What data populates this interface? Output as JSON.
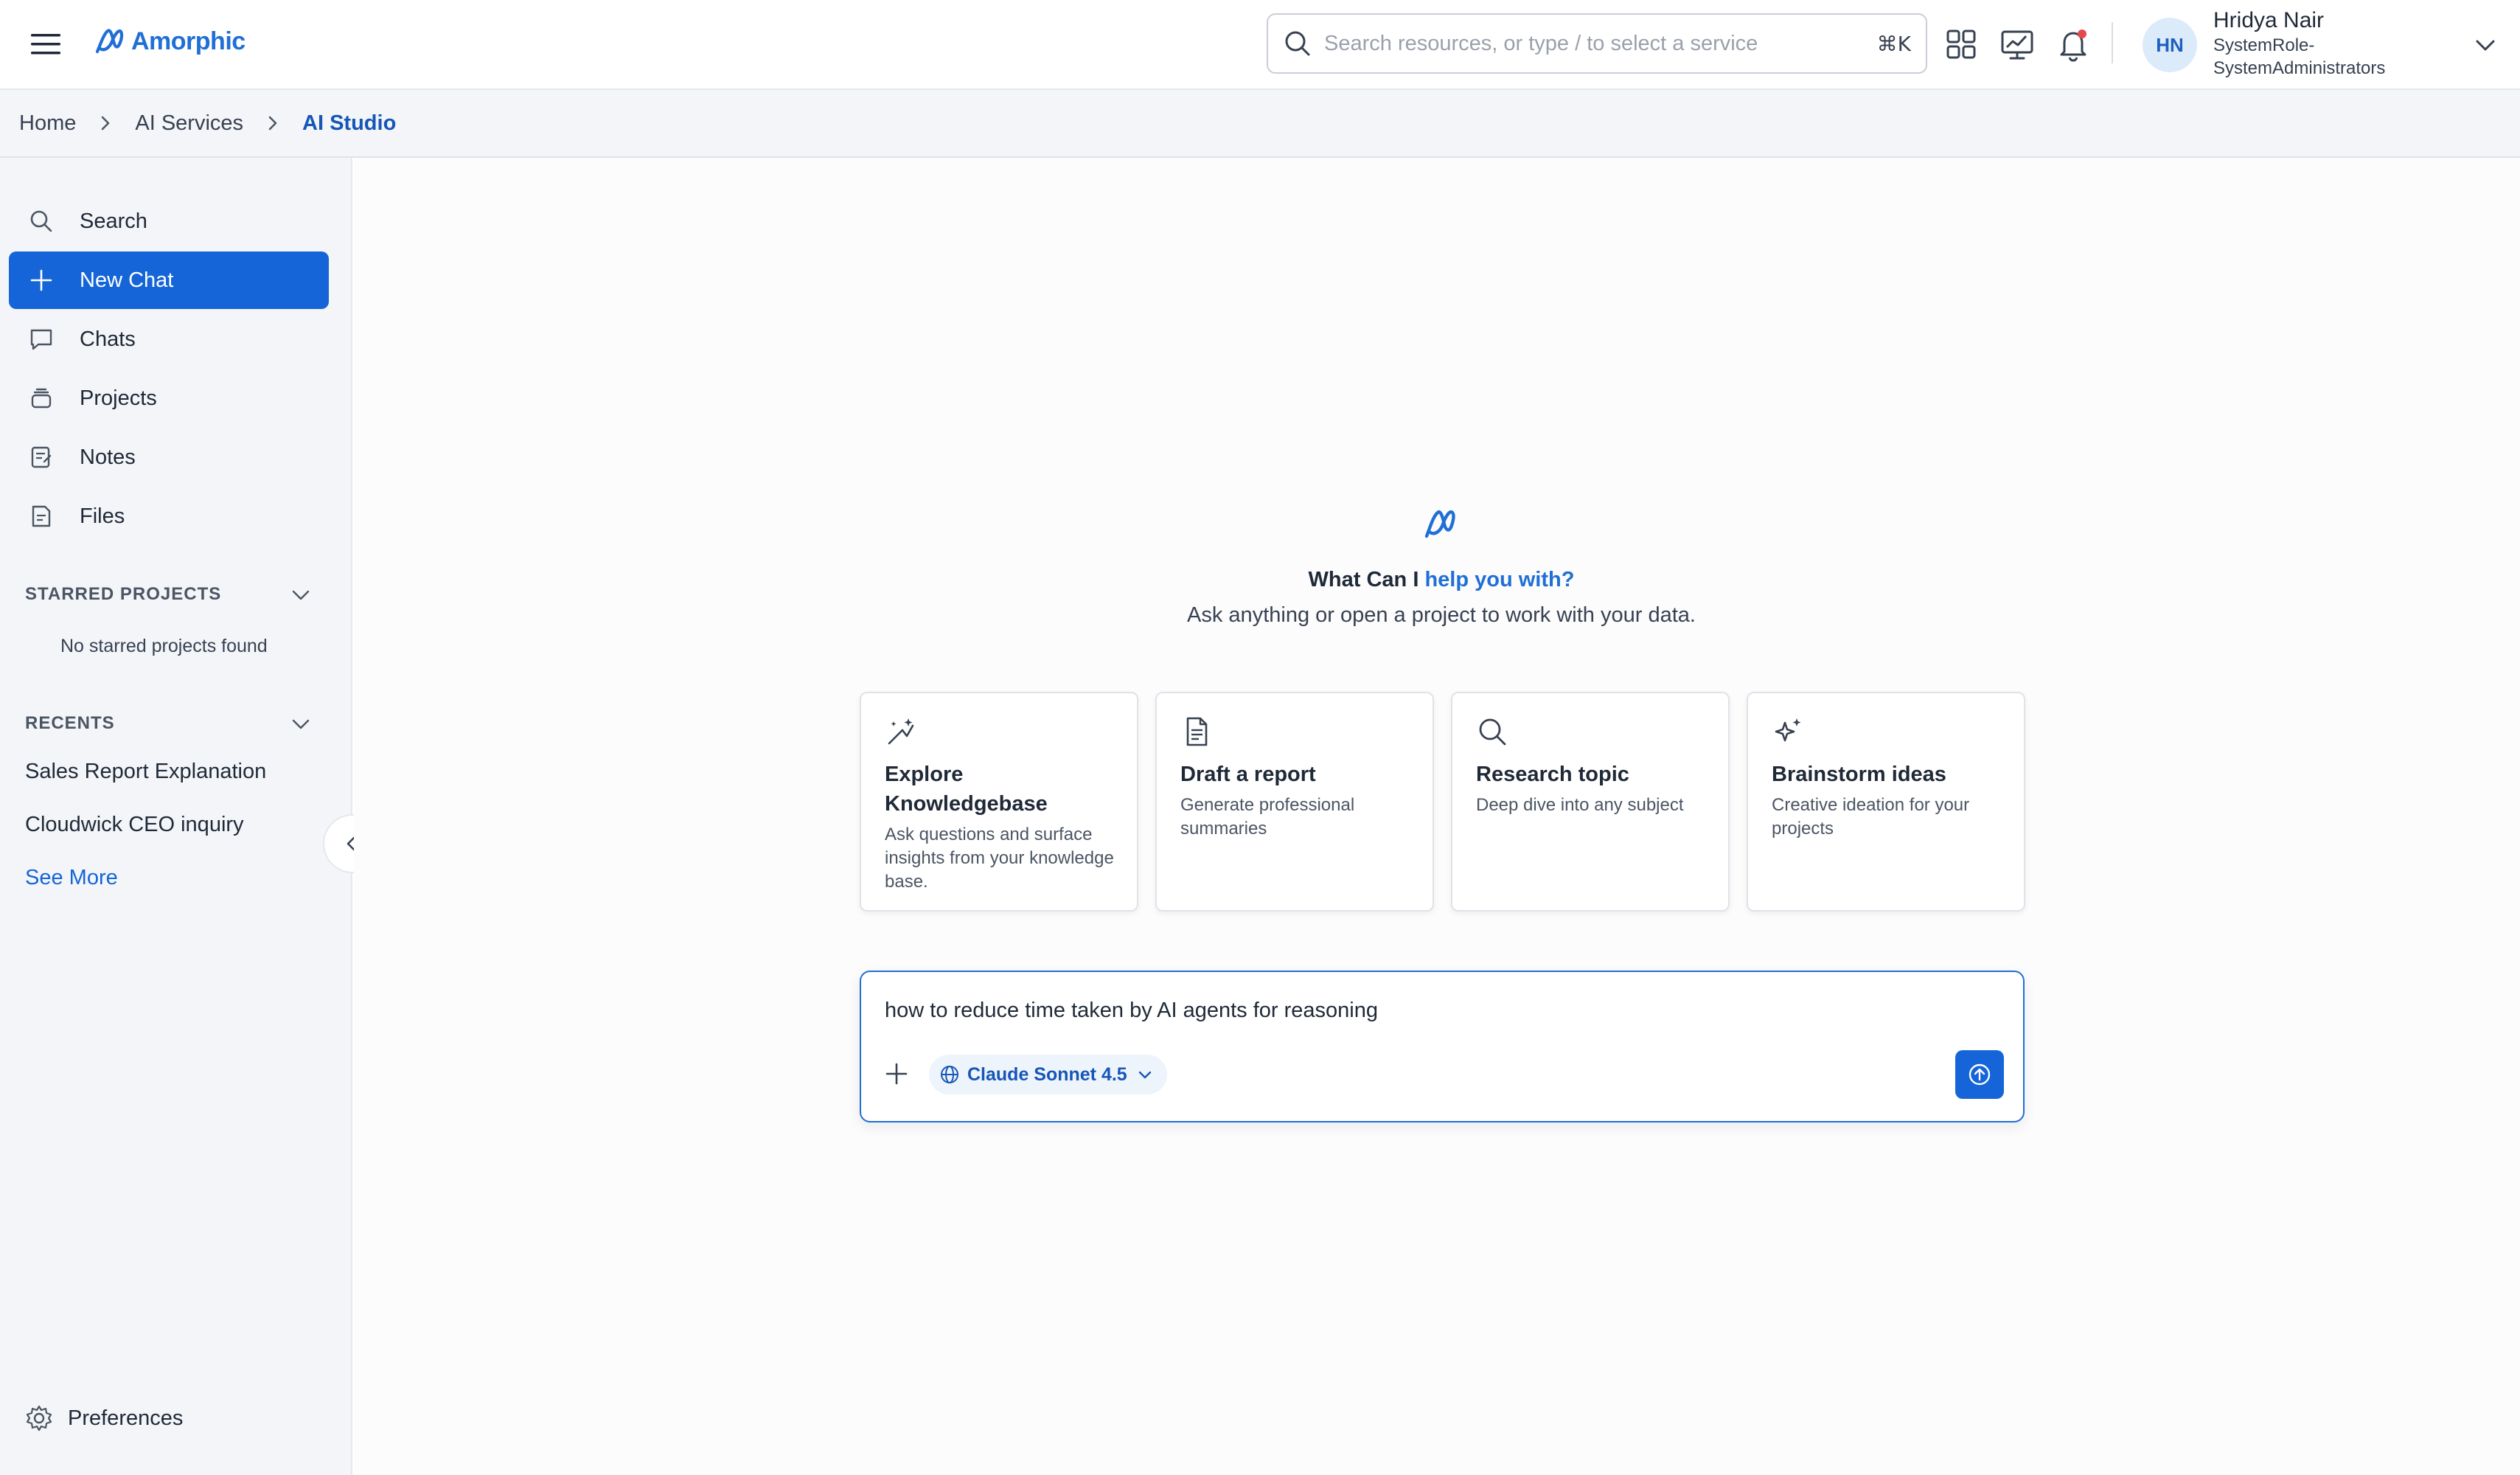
{
  "header": {
    "app_name": "Amorphic",
    "search_placeholder": "Search resources, or type / to select a service",
    "search_shortcut": "⌘K",
    "icons": [
      "menu-icon",
      "apps-grid-icon",
      "dashboard-chart-icon",
      "notification-bell-icon"
    ],
    "notification_dot_color": "#e5484d",
    "user": {
      "initials": "HN",
      "name": "Hridya Nair",
      "role_line1": "SystemRole-",
      "role_line2": "SystemAdministrators"
    }
  },
  "breadcrumb": {
    "items": [
      "Home",
      "AI Services",
      "AI Studio"
    ]
  },
  "sidebar": {
    "nav": [
      {
        "label": "Search",
        "icon": "search-icon"
      },
      {
        "label": "New Chat",
        "icon": "plus-icon",
        "active": true
      },
      {
        "label": "Chats",
        "icon": "chat-bubble-icon"
      },
      {
        "label": "Projects",
        "icon": "projects-stack-icon"
      },
      {
        "label": "Notes",
        "icon": "notes-icon"
      },
      {
        "label": "Files",
        "icon": "file-icon"
      }
    ],
    "starred": {
      "title": "STARRED PROJECTS",
      "empty_text": "No starred projects found"
    },
    "recents": {
      "title": "RECENTS",
      "items": [
        "Sales Report Explanation",
        "Cloudwick CEO inquiry"
      ],
      "see_more": "See More"
    },
    "preferences_label": "Preferences"
  },
  "main": {
    "prompt_title_part1": "What Can I ",
    "prompt_title_part2": "help you with?",
    "prompt_subtitle": "Ask anything or open a project to work with your data.",
    "cards": [
      {
        "title": "Explore Knowledgebase",
        "description": "Ask questions and surface insights from your knowledge base.",
        "icon": "magic-wand-icon"
      },
      {
        "title": "Draft a report",
        "description": "Generate professional summaries",
        "icon": "document-icon"
      },
      {
        "title": "Research topic",
        "description": "Deep dive into any subject",
        "icon": "search-icon"
      },
      {
        "title": "Brainstorm ideas",
        "description": "Creative ideation for your projects",
        "icon": "sparkle-icon"
      }
    ],
    "composer": {
      "value": "how to reduce time taken by AI agents for reasoning",
      "model": "Claude Sonnet 4.5"
    }
  },
  "colors": {
    "accent": "#1565d8",
    "brand": "#1f6fd6",
    "sidebar_bg": "#f3f5f8"
  }
}
